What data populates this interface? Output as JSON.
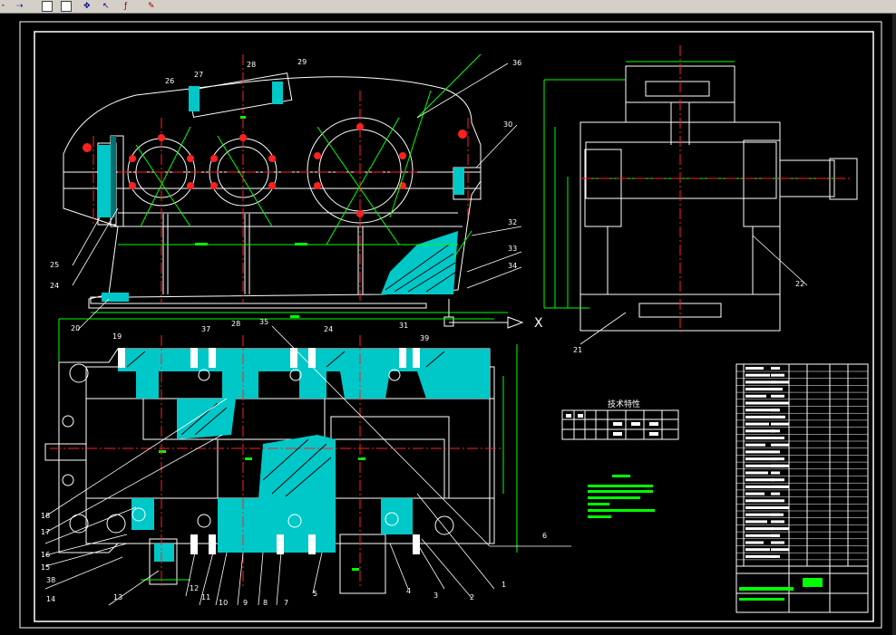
{
  "toolbar": {
    "icons": [
      "line-tool-icon",
      "arrow-tool-icon",
      "rectangle-icon",
      "square-icon",
      "move-icon",
      "pointer-icon",
      "text-cursor-icon",
      "paint-icon"
    ],
    "glyphs": {
      "g1": "╴",
      "g2": "⇢",
      "g5": "✥",
      "g6": "↖",
      "g7": "ƒ",
      "g8": "✎"
    }
  },
  "colors": {
    "background": "#000000",
    "frame": "#ffffff",
    "centerline": "#ff2020",
    "section": "#00d0d0",
    "green": "#00ff00",
    "lines": "#ffffff"
  },
  "labels": {
    "top_view": [
      "26",
      "27",
      "28",
      "29",
      "25",
      "24",
      "20",
      "36",
      "30",
      "32",
      "33",
      "34"
    ],
    "side_view": [
      "22",
      "21"
    ],
    "axis_x": "X",
    "plan_view": [
      "19",
      "37",
      "28",
      "35",
      "24",
      "31",
      "39",
      "18",
      "17",
      "16",
      "15",
      "38",
      "14",
      "13",
      "12",
      "11",
      "10",
      "9",
      "8",
      "7",
      "5",
      "4",
      "3",
      "2",
      "1",
      "6"
    ]
  },
  "spec_table": {
    "title": "技术特性"
  },
  "title_block": {
    "rows": 28
  }
}
